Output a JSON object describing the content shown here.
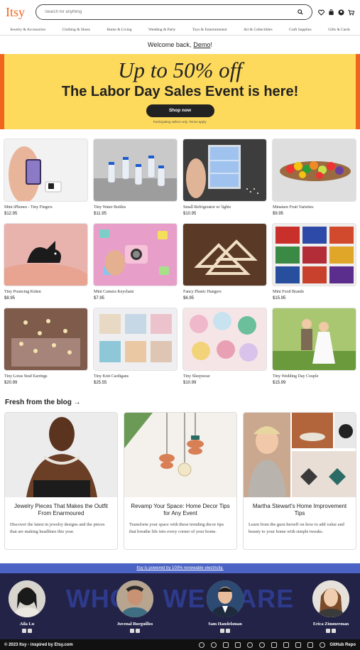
{
  "header": {
    "logo": "Itsy",
    "search_placeholder": "Search for anything",
    "icons": [
      "search-icon",
      "heart-icon",
      "bag-icon",
      "user-icon",
      "cart-icon"
    ]
  },
  "nav": [
    "Jewelry & Accessories",
    "Clothing & Shoes",
    "Home & Living",
    "Wedding & Party",
    "Toys & Entertainment",
    "Art & Collectibles",
    "Craft Supplies",
    "Gifts & Cards"
  ],
  "welcome": {
    "prefix": "Welcome back,",
    "name": "Demo",
    "suffix": "!"
  },
  "banner": {
    "line1": "Up to 50% off",
    "line2": "The Labor Day Sales Event is here!",
    "button": "Shop now",
    "fine_print": "Participating sellers only. Terms apply."
  },
  "products": [
    {
      "title": "Mini iPhones - Tiny Fingers",
      "price": "$12.95"
    },
    {
      "title": "Tiny Water Bottles",
      "price": "$11.95"
    },
    {
      "title": "Small Refrigerator w/ lights",
      "price": "$10.95"
    },
    {
      "title": "Minature Fruit Varieties",
      "price": "$9.95"
    },
    {
      "title": "Tiny Pouncing Kitten",
      "price": "$8.95"
    },
    {
      "title": "Mini Camera Keychain",
      "price": "$7.95"
    },
    {
      "title": "Fancy Plastic Hangers",
      "price": "$6.95"
    },
    {
      "title": "Mini Food Brands",
      "price": "$15.95"
    },
    {
      "title": "Tiny Lotus Stud Earrings",
      "price": "$20.99"
    },
    {
      "title": "Tiny Knit Cardigans",
      "price": "$25.55"
    },
    {
      "title": "Tiny Sleepwear",
      "price": "$10.99"
    },
    {
      "title": "Tiny Wedding Day Couple",
      "price": "$15.99"
    }
  ],
  "blog": {
    "heading": "Fresh from the blog →",
    "posts": [
      {
        "title": "Jewelry Pieces That Makes the Outfit From Enarmoured",
        "desc": "Discover the latest in jewelry designs and the pieces that are making headlines this year."
      },
      {
        "title": "Revamp Your Space: Home Decor Tips for Any Event",
        "desc": "Transform your space with these trending decor tips that breathe life into every corner of your home."
      },
      {
        "title": "Martha Stewart's Home Improvement Tips",
        "desc": "Learn from the guru herself on how to add value and beauty to your home with simple tweaks."
      }
    ]
  },
  "footer": {
    "renewable": "Itsy is powered by 100% renewable electricity.",
    "who_words": [
      "WHO",
      "WE",
      "ARE"
    ],
    "team": [
      {
        "name": "Aila Lu"
      },
      {
        "name": "Juvenal Burguillos"
      },
      {
        "name": "Sam Handelsman"
      },
      {
        "name": "Erica Zimmerman"
      }
    ],
    "copyright": "© 2023 Itsy - inspired by Etsy.com",
    "repo": "GitHub Repo"
  }
}
